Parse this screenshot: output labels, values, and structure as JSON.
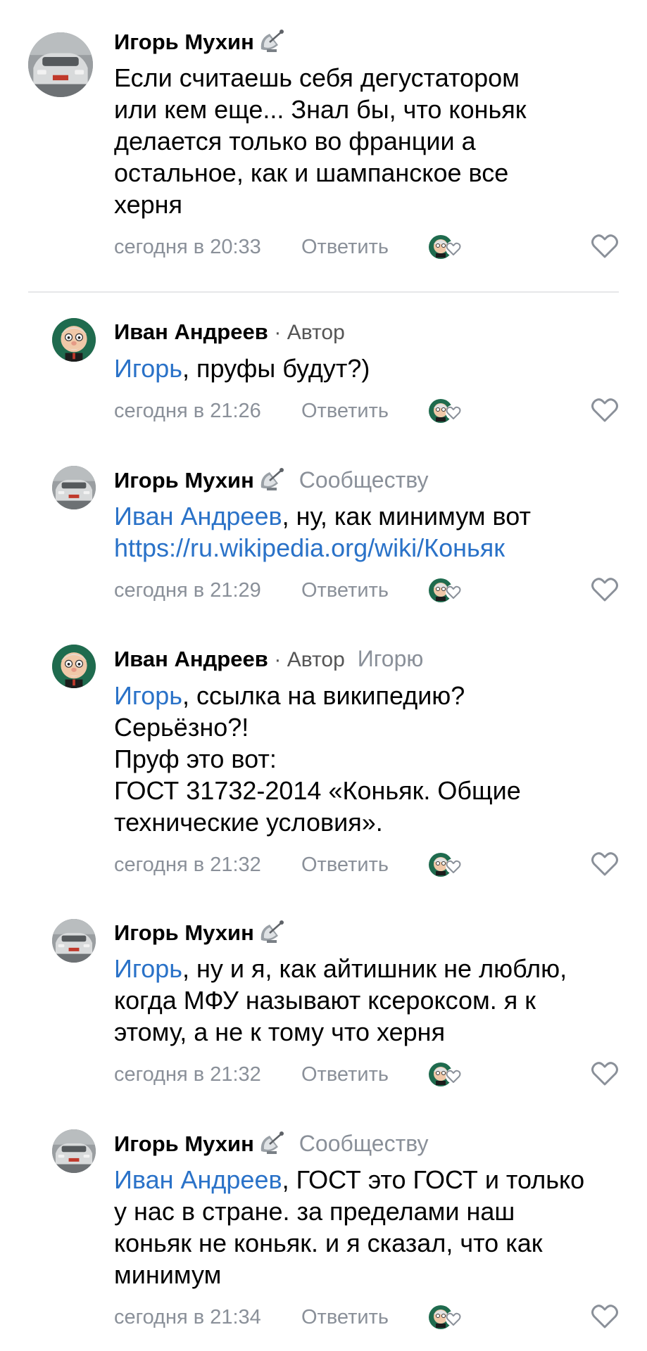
{
  "colors": {
    "link": "#2a72c8",
    "meta": "#8a9099",
    "divider": "#e6e7e9"
  },
  "icons": {
    "sat": "satellite-dish-icon",
    "heart": "heart-outline-icon",
    "likers": "liker-avatar-heart-icon"
  },
  "comments": [
    {
      "author": "Игорь Мухин",
      "role": "",
      "reply_to": "",
      "mention": "",
      "lines": [
        "Если считаешь себя дегустатором",
        "или кем еще... Знал бы, что коньяк",
        "делается только во франции  а",
        "остальное, как и шампанское все",
        "херня"
      ],
      "time": "сегодня в 20:33",
      "reply_label": "Ответить"
    },
    {
      "author": "Иван Андреев",
      "role": "· Автор",
      "reply_to": "",
      "mention": "Игорь",
      "lines": [
        ", пруфы будут?)"
      ],
      "time": "сегодня в 21:26",
      "reply_label": "Ответить"
    },
    {
      "author": "Игорь Мухин",
      "role": "",
      "reply_to": "Сообществу",
      "mention": "Иван Андреев",
      "lines": [
        ", ну, как минимум вот"
      ],
      "link": "https://ru.wikipedia.org/wiki/Коньяк",
      "time": "сегодня в 21:29",
      "reply_label": "Ответить"
    },
    {
      "author": "Иван Андреев",
      "role": "· Автор",
      "reply_to": "Игорю",
      "mention": "Игорь",
      "lines": [
        ", ссылка на википедию?",
        "Серьёзно?!",
        "Пруф это вот:",
        "ГОСТ 31732-2014 «Коньяк. Общие",
        "технические условия»."
      ],
      "time": "сегодня в 21:32",
      "reply_label": "Ответить"
    },
    {
      "author": "Игорь Мухин",
      "role": "",
      "reply_to": "",
      "mention": "Игорь",
      "lines": [
        ", ну и я, как айтишник не люблю,",
        "когда МФУ называют ксероксом. я к",
        "этому, а не к тому что херня"
      ],
      "time": "сегодня в 21:32",
      "reply_label": "Ответить"
    },
    {
      "author": "Игорь Мухин",
      "role": "",
      "reply_to": "Сообществу",
      "mention": "Иван Андреев",
      "lines": [
        ", ГОСТ это ГОСТ и только",
        "у нас в стране. за пределами наш",
        "коньяк не коньяк. и я сказал, что как",
        "минимум"
      ],
      "time": "сегодня в 21:34",
      "reply_label": "Ответить"
    }
  ]
}
